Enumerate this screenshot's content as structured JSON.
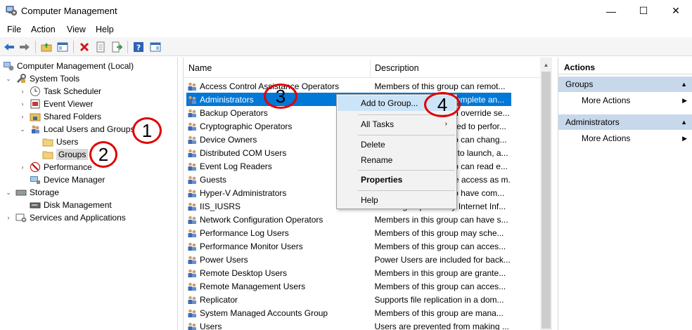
{
  "window": {
    "title": "Computer Management",
    "minimize": "—",
    "maximize": "☐",
    "close": "✕"
  },
  "menu": {
    "file": "File",
    "action": "Action",
    "view": "View",
    "help": "Help"
  },
  "toolbar": {
    "buttons": [
      "back-icon",
      "forward-icon",
      "up-folder-icon",
      "show-hide-tree-icon",
      "delete-icon",
      "properties-icon",
      "export-list-icon",
      "help-icon",
      "show-hide-action-pane-icon"
    ]
  },
  "tree": {
    "root": "Computer Management (Local)",
    "system_tools": "System Tools",
    "task_scheduler": "Task Scheduler",
    "event_viewer": "Event Viewer",
    "shared_folders": "Shared Folders",
    "local_users_groups": "Local Users and Groups",
    "users": "Users",
    "groups": "Groups",
    "performance": "Performance",
    "device_manager": "Device Manager",
    "storage": "Storage",
    "disk_management": "Disk Management",
    "services_apps": "Services and Applications"
  },
  "list": {
    "col_name": "Name",
    "col_description": "Description",
    "rows": [
      {
        "name": "Access Control Assistance Operators",
        "desc": "Members of this group can remot..."
      },
      {
        "name": "Administrators",
        "desc": "Administrators have complete an..."
      },
      {
        "name": "Backup Operators",
        "desc": "Backup Operators can override se..."
      },
      {
        "name": "Cryptographic Operators",
        "desc": "Members are authorized to perfor..."
      },
      {
        "name": "Device Owners",
        "desc": "Members of this group can chang..."
      },
      {
        "name": "Distributed COM Users",
        "desc": "Members are allowed to launch, a..."
      },
      {
        "name": "Event Log Readers",
        "desc": "Members of this group can read e..."
      },
      {
        "name": "Guests",
        "desc": "Guests have the same access as m..."
      },
      {
        "name": "Hyper-V Administrators",
        "desc": "Members of this group have com..."
      },
      {
        "name": "IIS_IUSRS",
        "desc": "Built-in group used by Internet Inf..."
      },
      {
        "name": "Network Configuration Operators",
        "desc": "Members in this group can have s..."
      },
      {
        "name": "Performance Log Users",
        "desc": "Members of this group may sche..."
      },
      {
        "name": "Performance Monitor Users",
        "desc": "Members of this group can acces..."
      },
      {
        "name": "Power Users",
        "desc": "Power Users are included for back..."
      },
      {
        "name": "Remote Desktop Users",
        "desc": "Members in this group are grante..."
      },
      {
        "name": "Remote Management Users",
        "desc": "Members of this group can acces..."
      },
      {
        "name": "Replicator",
        "desc": "Supports file replication in a dom..."
      },
      {
        "name": "System Managed Accounts Group",
        "desc": "Members of this group are mana..."
      },
      {
        "name": "Users",
        "desc": "Users are prevented from making ..."
      }
    ]
  },
  "context_menu": {
    "add_to_group": "Add to Group...",
    "all_tasks": "All Tasks",
    "delete": "Delete",
    "rename": "Rename",
    "properties": "Properties",
    "help": "Help"
  },
  "actions": {
    "title": "Actions",
    "section1": "Groups",
    "section1_item": "More Actions",
    "section2": "Administrators",
    "section2_item": "More Actions"
  },
  "callouts": [
    "1",
    "2",
    "3",
    "4"
  ],
  "colors": {
    "selection": "#0078d7",
    "menu_hover": "#cce4f7",
    "action_header": "#c7d8ea",
    "callout": "#e00000"
  }
}
